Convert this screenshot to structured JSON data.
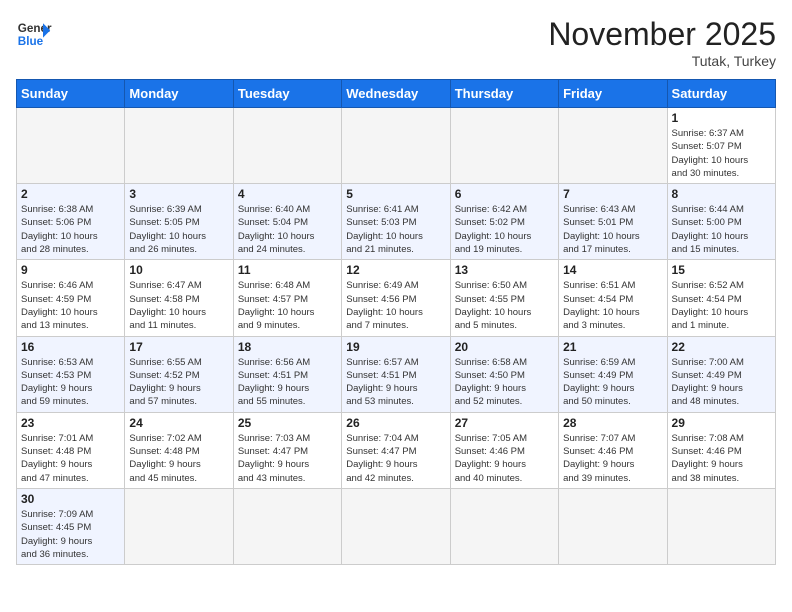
{
  "header": {
    "logo_general": "General",
    "logo_blue": "Blue",
    "month_title": "November 2025",
    "location": "Tutak, Turkey"
  },
  "weekdays": [
    "Sunday",
    "Monday",
    "Tuesday",
    "Wednesday",
    "Thursday",
    "Friday",
    "Saturday"
  ],
  "weeks": [
    [
      {
        "day": "",
        "info": ""
      },
      {
        "day": "",
        "info": ""
      },
      {
        "day": "",
        "info": ""
      },
      {
        "day": "",
        "info": ""
      },
      {
        "day": "",
        "info": ""
      },
      {
        "day": "",
        "info": ""
      },
      {
        "day": "1",
        "info": "Sunrise: 6:37 AM\nSunset: 5:07 PM\nDaylight: 10 hours\nand 30 minutes."
      }
    ],
    [
      {
        "day": "2",
        "info": "Sunrise: 6:38 AM\nSunset: 5:06 PM\nDaylight: 10 hours\nand 28 minutes."
      },
      {
        "day": "3",
        "info": "Sunrise: 6:39 AM\nSunset: 5:05 PM\nDaylight: 10 hours\nand 26 minutes."
      },
      {
        "day": "4",
        "info": "Sunrise: 6:40 AM\nSunset: 5:04 PM\nDaylight: 10 hours\nand 24 minutes."
      },
      {
        "day": "5",
        "info": "Sunrise: 6:41 AM\nSunset: 5:03 PM\nDaylight: 10 hours\nand 21 minutes."
      },
      {
        "day": "6",
        "info": "Sunrise: 6:42 AM\nSunset: 5:02 PM\nDaylight: 10 hours\nand 19 minutes."
      },
      {
        "day": "7",
        "info": "Sunrise: 6:43 AM\nSunset: 5:01 PM\nDaylight: 10 hours\nand 17 minutes."
      },
      {
        "day": "8",
        "info": "Sunrise: 6:44 AM\nSunset: 5:00 PM\nDaylight: 10 hours\nand 15 minutes."
      }
    ],
    [
      {
        "day": "9",
        "info": "Sunrise: 6:46 AM\nSunset: 4:59 PM\nDaylight: 10 hours\nand 13 minutes."
      },
      {
        "day": "10",
        "info": "Sunrise: 6:47 AM\nSunset: 4:58 PM\nDaylight: 10 hours\nand 11 minutes."
      },
      {
        "day": "11",
        "info": "Sunrise: 6:48 AM\nSunset: 4:57 PM\nDaylight: 10 hours\nand 9 minutes."
      },
      {
        "day": "12",
        "info": "Sunrise: 6:49 AM\nSunset: 4:56 PM\nDaylight: 10 hours\nand 7 minutes."
      },
      {
        "day": "13",
        "info": "Sunrise: 6:50 AM\nSunset: 4:55 PM\nDaylight: 10 hours\nand 5 minutes."
      },
      {
        "day": "14",
        "info": "Sunrise: 6:51 AM\nSunset: 4:54 PM\nDaylight: 10 hours\nand 3 minutes."
      },
      {
        "day": "15",
        "info": "Sunrise: 6:52 AM\nSunset: 4:54 PM\nDaylight: 10 hours\nand 1 minute."
      }
    ],
    [
      {
        "day": "16",
        "info": "Sunrise: 6:53 AM\nSunset: 4:53 PM\nDaylight: 9 hours\nand 59 minutes."
      },
      {
        "day": "17",
        "info": "Sunrise: 6:55 AM\nSunset: 4:52 PM\nDaylight: 9 hours\nand 57 minutes."
      },
      {
        "day": "18",
        "info": "Sunrise: 6:56 AM\nSunset: 4:51 PM\nDaylight: 9 hours\nand 55 minutes."
      },
      {
        "day": "19",
        "info": "Sunrise: 6:57 AM\nSunset: 4:51 PM\nDaylight: 9 hours\nand 53 minutes."
      },
      {
        "day": "20",
        "info": "Sunrise: 6:58 AM\nSunset: 4:50 PM\nDaylight: 9 hours\nand 52 minutes."
      },
      {
        "day": "21",
        "info": "Sunrise: 6:59 AM\nSunset: 4:49 PM\nDaylight: 9 hours\nand 50 minutes."
      },
      {
        "day": "22",
        "info": "Sunrise: 7:00 AM\nSunset: 4:49 PM\nDaylight: 9 hours\nand 48 minutes."
      }
    ],
    [
      {
        "day": "23",
        "info": "Sunrise: 7:01 AM\nSunset: 4:48 PM\nDaylight: 9 hours\nand 47 minutes."
      },
      {
        "day": "24",
        "info": "Sunrise: 7:02 AM\nSunset: 4:48 PM\nDaylight: 9 hours\nand 45 minutes."
      },
      {
        "day": "25",
        "info": "Sunrise: 7:03 AM\nSunset: 4:47 PM\nDaylight: 9 hours\nand 43 minutes."
      },
      {
        "day": "26",
        "info": "Sunrise: 7:04 AM\nSunset: 4:47 PM\nDaylight: 9 hours\nand 42 minutes."
      },
      {
        "day": "27",
        "info": "Sunrise: 7:05 AM\nSunset: 4:46 PM\nDaylight: 9 hours\nand 40 minutes."
      },
      {
        "day": "28",
        "info": "Sunrise: 7:07 AM\nSunset: 4:46 PM\nDaylight: 9 hours\nand 39 minutes."
      },
      {
        "day": "29",
        "info": "Sunrise: 7:08 AM\nSunset: 4:46 PM\nDaylight: 9 hours\nand 38 minutes."
      }
    ],
    [
      {
        "day": "30",
        "info": "Sunrise: 7:09 AM\nSunset: 4:45 PM\nDaylight: 9 hours\nand 36 minutes."
      },
      {
        "day": "",
        "info": ""
      },
      {
        "day": "",
        "info": ""
      },
      {
        "day": "",
        "info": ""
      },
      {
        "day": "",
        "info": ""
      },
      {
        "day": "",
        "info": ""
      },
      {
        "day": "",
        "info": ""
      }
    ]
  ],
  "row_styles": [
    "white",
    "alt",
    "white",
    "alt",
    "white",
    "alt"
  ]
}
